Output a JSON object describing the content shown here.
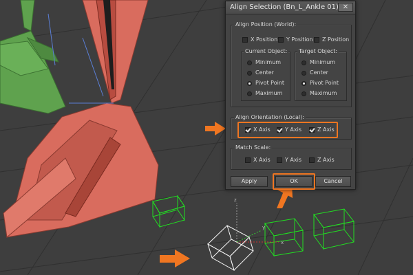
{
  "dialog": {
    "title": "Align Selection (Bn_L_Ankle 01)",
    "close_glyph": "✕",
    "align_position": {
      "label": "Align Position (World):",
      "x": {
        "label": "X Position",
        "checked": false
      },
      "y": {
        "label": "Y Position",
        "checked": false
      },
      "z": {
        "label": "Z Position",
        "checked": false
      }
    },
    "current_object": {
      "label": "Current Object:",
      "options": [
        "Minimum",
        "Center",
        "Pivot Point",
        "Maximum"
      ],
      "selected": "Pivot Point"
    },
    "target_object": {
      "label": "Target Object:",
      "options": [
        "Minimum",
        "Center",
        "Pivot Point",
        "Maximum"
      ],
      "selected": "Pivot Point"
    },
    "align_orientation": {
      "label": "Align Orientation (Local):",
      "x": {
        "label": "X Axis",
        "checked": true
      },
      "y": {
        "label": "Y Axis",
        "checked": true
      },
      "z": {
        "label": "Z Axis",
        "checked": true
      }
    },
    "match_scale": {
      "label": "Match Scale:",
      "x": {
        "label": "X Axis",
        "checked": false
      },
      "y": {
        "label": "Y Axis",
        "checked": false
      },
      "z": {
        "label": "Z Axis",
        "checked": false
      }
    },
    "buttons": {
      "apply": "Apply",
      "ok": "OK",
      "cancel": "Cancel"
    }
  },
  "viewport": {
    "axis_labels": {
      "z": "z",
      "x": "x",
      "y": "y"
    }
  },
  "colors": {
    "annotation_orange": "#f07621",
    "viewport_bg": "#3e3e3e",
    "bone_red": "#d96c5e",
    "bone_green": "#5fa24e",
    "helper_green": "#22dd22",
    "dialog_bg": "#444444"
  },
  "icons": [
    "close-icon",
    "annotation-arrow-icon"
  ]
}
